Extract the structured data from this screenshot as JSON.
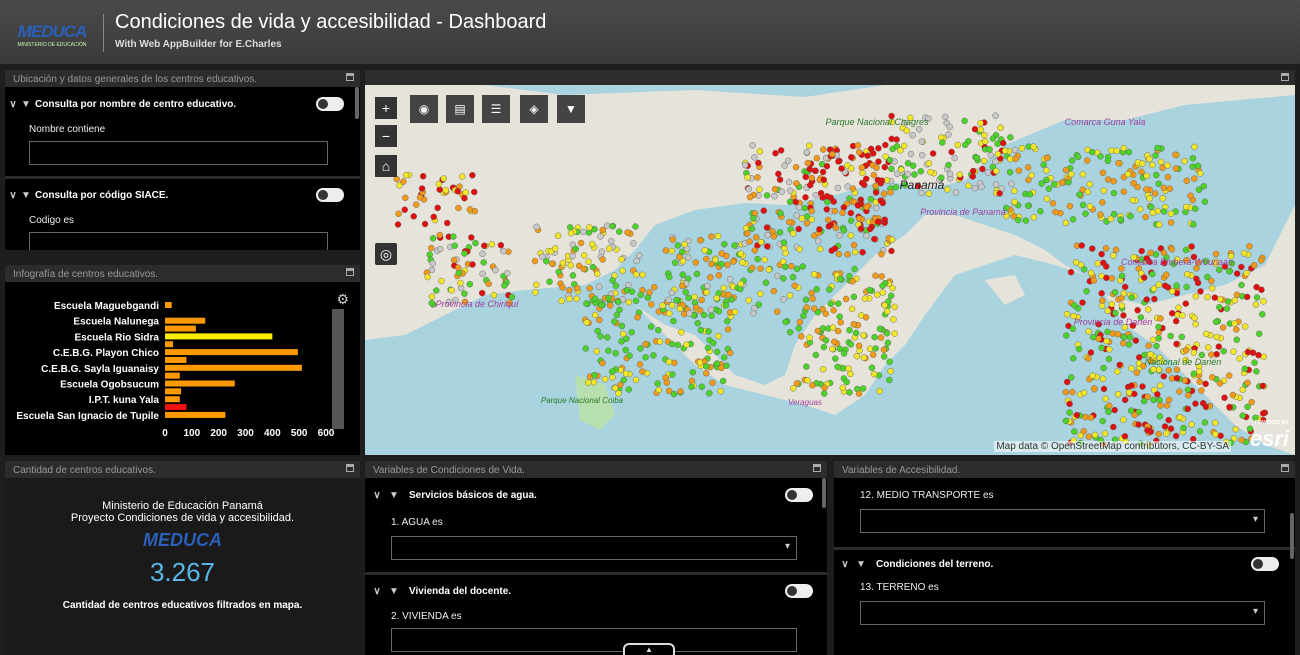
{
  "header": {
    "logo_text": "MEDUCA",
    "logo_sub": "MINISTERIO DE EDUCACIÓN",
    "title": "Condiciones de vida y accesibilidad - Dashboard",
    "subtitle": "With Web AppBuilder for E.Charles"
  },
  "panel_ubicacion": {
    "title": "Ubicación y datos generales de los centros educativos.",
    "filters": [
      {
        "label": "Consulta por nombre de centro educativo.",
        "field_label": "Nombre contiene"
      },
      {
        "label": "Consulta por código SIACE.",
        "field_label": "Codigo es"
      }
    ]
  },
  "panel_infografia": {
    "title": "Infografía de centros educativos.",
    "chart_data": {
      "type": "bar",
      "orientation": "horizontal",
      "categories": [
        "Escuela Maguebgandi",
        "",
        "Escuela Nalunega",
        "",
        "Escuela Rio Sidra",
        "",
        "C.E.B.G. Playon Chico",
        "",
        "C.E.B.G. Sayla Iguanaisy",
        "",
        "Escuela Ogobsucum",
        "",
        "I.P.T. kuna Yala",
        "",
        "Escuela San Ignacio de Tupile"
      ],
      "labels_shown": [
        "Escuela Maguebgandi",
        "Escuela Nalunega",
        "Escuela Rio Sidra",
        "C.E.B.G. Playon Chico",
        "C.E.B.G. Sayla Iguanaisy",
        "Escuela Ogobsucum",
        "I.P.T. kuna Yala",
        "Escuela San Ignacio de Tupile"
      ],
      "values": [
        25,
        0,
        150,
        115,
        400,
        30,
        495,
        80,
        510,
        55,
        260,
        60,
        55,
        80,
        225
      ],
      "bar_colors": [
        "#ff9900",
        "#ff9900",
        "#ff9900",
        "#ff9900",
        "#ffee00",
        "#ff9900",
        "#ff9900",
        "#ff9900",
        "#ff9900",
        "#ff9900",
        "#ff9900",
        "#ff9900",
        "#ff9900",
        "#ee1111",
        "#ff9900"
      ],
      "xticks": [
        "0",
        "100",
        "200",
        "300",
        "400",
        "500",
        "600"
      ],
      "xlim": [
        0,
        600
      ]
    }
  },
  "panel_cantidad": {
    "title": "Cantidad de centros educativos.",
    "line1": "Ministerio de Educación Panamá",
    "line2": "Proyecto Condiciones de vida y accesibilidad.",
    "logo_text": "MEDUCA",
    "count": "3.267",
    "caption": "Cantidad de centros educativos filtrados en mapa."
  },
  "panel_vida": {
    "title": "Variables de Condiciones de Vida.",
    "filters": [
      {
        "label": "Servicios básicos de agua.",
        "field_label": "1. AGUA es"
      },
      {
        "label": "Vivienda del docente.",
        "field_label": "2. VIVIENDA es"
      }
    ]
  },
  "panel_accesibilidad": {
    "title": "Variables de Accesibilidad.",
    "field1_label": "12. MEDIO TRANSPORTE es",
    "filter_label": "Condiciones del terreno.",
    "field2_label": "13. TERRENO es"
  },
  "map": {
    "labels": [
      "Panamá",
      "Provincia de Panamá",
      "Provincia de Chiriquí",
      "Provincia de Darién",
      "Comarca Emberá-Wounaan",
      "Parque Nacional Chagres",
      "Comarca Guna Yala",
      "Parque Nacional Coiba",
      "Nacional de Darién",
      "Veraguas"
    ],
    "attribution": "Map data © OpenStreetMap contributors, CC-BY-SA",
    "esri_text": "esri",
    "esri_powered": "POWERED BY",
    "colors": {
      "green": "#4cd22a",
      "yellow": "#f2e62a",
      "orange": "#f29a1a",
      "red": "#e01010",
      "gray": "#c8c8c8"
    }
  }
}
